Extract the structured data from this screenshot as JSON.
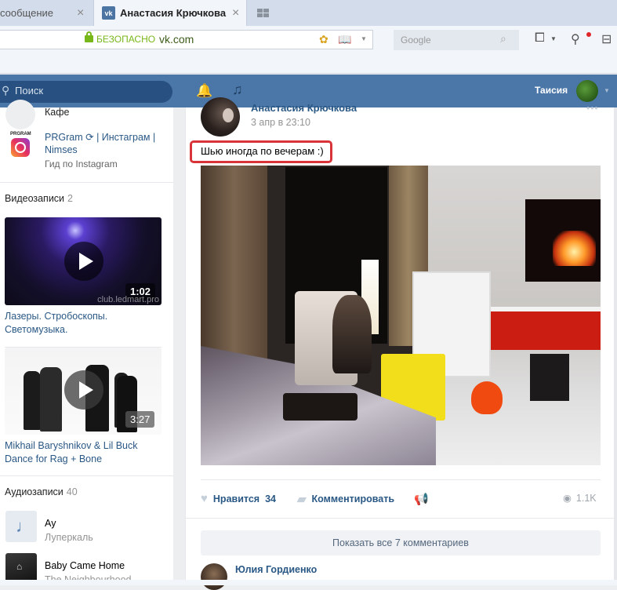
{
  "browser": {
    "tabs": [
      {
        "label": "сообщение",
        "active": false
      },
      {
        "label": "Анастасия Крючкова",
        "active": true
      }
    ],
    "address": {
      "security_label": "БЕЗОПАСНО",
      "url": "vk.com"
    },
    "search_placeholder": "Google",
    "colors": {
      "secure_green": "#78b71a",
      "notification_dot": "#e0252b"
    }
  },
  "header": {
    "search_placeholder": "Поиск",
    "user_name": "Таисия",
    "brand_color": "#4a76a8"
  },
  "sidebar": {
    "communities": [
      {
        "name": "Кафе",
        "subtitle": ""
      },
      {
        "name": "PRGram ⟳ | Инстаграм | Nimses",
        "name_line1": "PRGram",
        "name_line1b": "| Инстаграм |",
        "name_line2": "Nimses",
        "subtitle": "Гид по Instagram",
        "logo_text": "PRGRAM"
      }
    ],
    "videos": {
      "title": "Видеозаписи",
      "count": "2",
      "items": [
        {
          "title_line1": "Лазеры. Стробоскопы.",
          "title_line2": "Светомузыка.",
          "duration": "1:02",
          "watermark": "club.ledmart.pro"
        },
        {
          "title_line1": "Mikhail Baryshnikov & Lil Buck",
          "title_line2": "Dance for Rag + Bone",
          "duration": "3:27"
        }
      ]
    },
    "audio": {
      "title": "Аудиозаписи",
      "count": "40",
      "items": [
        {
          "title": "Ау",
          "artist": "Луперкаль"
        },
        {
          "title": "Baby Came Home",
          "artist": "The Neighbourhood"
        }
      ]
    }
  },
  "post": {
    "author": "Анастасия Крючкова",
    "date": "3 апр в 23:10",
    "text": "Шью иногда по вечерам :)",
    "actions": {
      "like_label": "Нравится",
      "like_count": "34",
      "comment_label": "Комментировать",
      "views": "1.1K"
    },
    "show_comments_label": "Показать все 7 комментариев",
    "first_comment_author": "Юлия Гордиенко",
    "highlight_color": "#d9343a"
  }
}
